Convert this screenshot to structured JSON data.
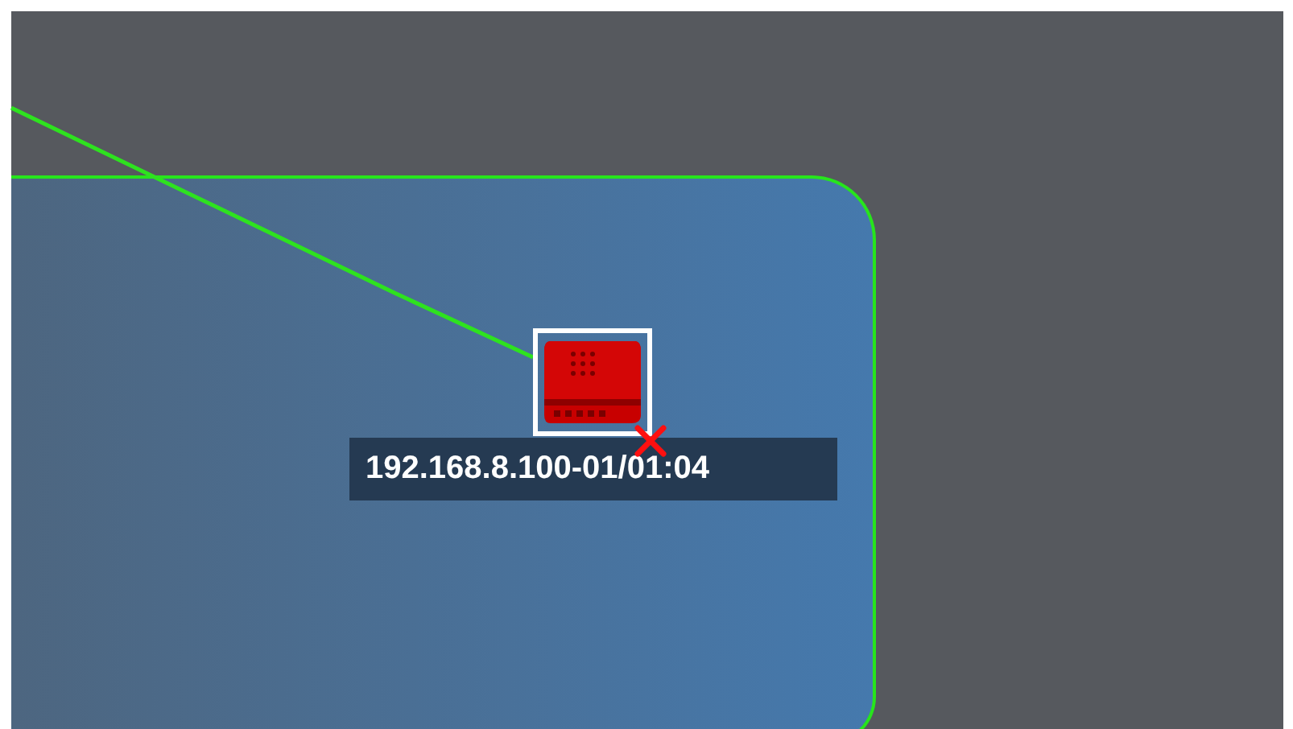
{
  "device": {
    "label": "192.168.8.100-01/01:04",
    "selected": true,
    "alarm": true
  }
}
